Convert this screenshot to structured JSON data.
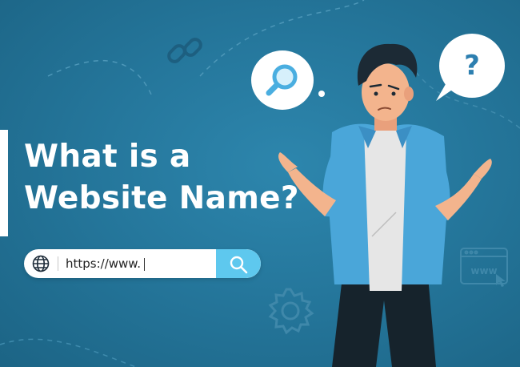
{
  "headline": {
    "line1": "What is a",
    "line2": "Website Name?"
  },
  "search": {
    "url_text": "https://www.",
    "search_icon": "magnifier-icon",
    "globe_icon": "globe-icon"
  },
  "bubbles": {
    "left": "magnifier-icon",
    "right_text": "?"
  },
  "decorations": {
    "browser_text": "www",
    "icons": [
      "link-icon",
      "gear-icon",
      "browser-window-icon",
      "cursor-icon"
    ]
  },
  "colors": {
    "background": "#25779c",
    "accent": "#5ec8ee",
    "shirt": "#4aa6d9",
    "text": "#ffffff"
  }
}
